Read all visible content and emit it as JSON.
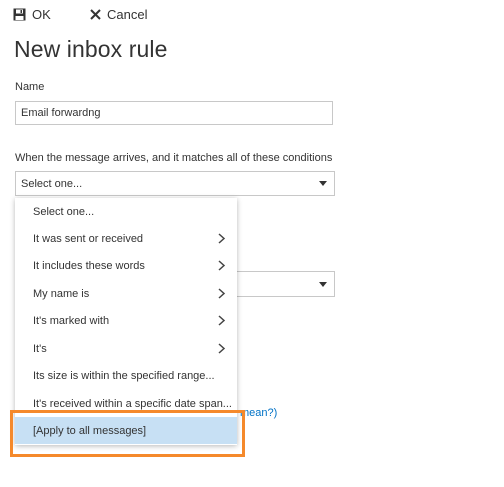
{
  "toolbar": {
    "ok_label": "OK",
    "cancel_label": "Cancel"
  },
  "page": {
    "title": "New inbox rule"
  },
  "name_field": {
    "label": "Name",
    "value": "Email forwardng"
  },
  "condition": {
    "label": "When the message arrives, and it matches all of these conditions",
    "selected_value": "Select one..."
  },
  "dropdown": {
    "items": [
      {
        "label": "Select one...",
        "has_submenu": false
      },
      {
        "label": "It was sent or received",
        "has_submenu": true
      },
      {
        "label": "It includes these words",
        "has_submenu": true
      },
      {
        "label": "My name is",
        "has_submenu": true
      },
      {
        "label": "It's marked with",
        "has_submenu": true
      },
      {
        "label": "It's",
        "has_submenu": true
      },
      {
        "label": "Its size is within the specified range...",
        "has_submenu": false
      },
      {
        "label": "It's received within a specific date span...",
        "has_submenu": false
      },
      {
        "label": "[Apply to all messages]",
        "has_submenu": false,
        "selected": true
      }
    ]
  },
  "help_link_fragment": "mean?)",
  "colors": {
    "highlight_border": "#f5892b",
    "selected_item_bg": "#c7e0f4",
    "link": "#0072c6"
  },
  "icons": {
    "ok": "save-disk-icon",
    "cancel": "close-x-icon",
    "submenu": "chevron-right-icon",
    "select": "caret-down-icon"
  }
}
